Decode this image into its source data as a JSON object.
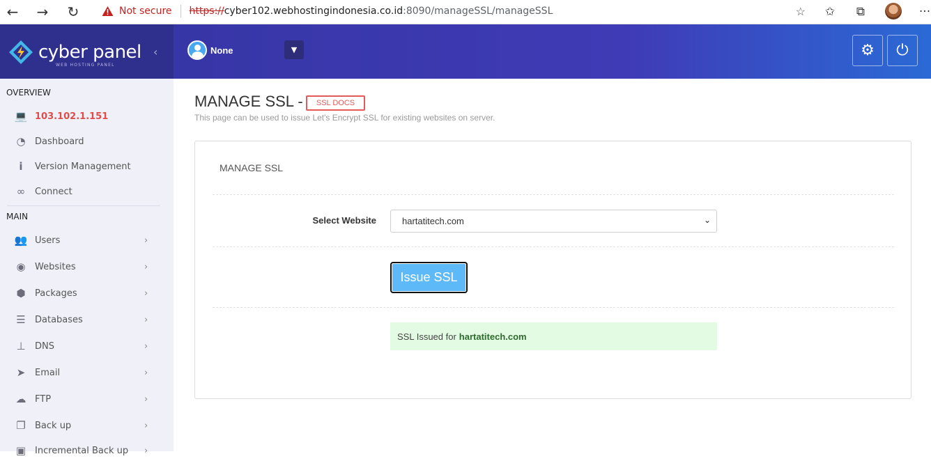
{
  "browser": {
    "security_label": "Not secure",
    "url_scheme": "https://",
    "url_host": "cyber102.webhostingindonesia.co.id",
    "url_rest": ":8090/manageSSL/manageSSL",
    "icons": [
      "back-icon",
      "forward-icon",
      "reload-icon",
      "warning-icon",
      "add-favorite-icon",
      "favorites-icon",
      "collections-icon",
      "profile-avatar",
      "more-icon"
    ]
  },
  "brand": {
    "name": "cyber panel",
    "tagline": "WEB HOSTING PANEL"
  },
  "sidebar": {
    "overview_heading": "OVERVIEW",
    "main_heading": "MAIN",
    "overview_items": [
      {
        "label": "103.102.1.151",
        "icon": "laptop-icon"
      },
      {
        "label": "Dashboard",
        "icon": "dashboard-icon"
      },
      {
        "label": "Version Management",
        "icon": "info-icon"
      },
      {
        "label": "Connect",
        "icon": "link-icon"
      }
    ],
    "main_items": [
      {
        "label": "Users",
        "icon": "users-icon"
      },
      {
        "label": "Websites",
        "icon": "globe-icon"
      },
      {
        "label": "Packages",
        "icon": "cubes-icon"
      },
      {
        "label": "Databases",
        "icon": "database-icon"
      },
      {
        "label": "DNS",
        "icon": "sitemap-icon"
      },
      {
        "label": "Email",
        "icon": "paper-plane-icon"
      },
      {
        "label": "FTP",
        "icon": "cloud-upload-icon"
      },
      {
        "label": "Back up",
        "icon": "copy-icon"
      },
      {
        "label": "Incremental Back up",
        "icon": "save-icon"
      }
    ]
  },
  "header": {
    "user_name": "None"
  },
  "main": {
    "page_title": "MANAGE SSL -",
    "docs_label": "SSL DOCS",
    "description": "This page can be used to issue Let's Encrypt SSL for existing websites on server.",
    "panel_title": "MANAGE SSL",
    "select_label": "Select Website",
    "selected_website": "hartatitech.com",
    "issue_button": "Issue SSL",
    "alert_text": "SSL Issued for",
    "alert_site": "hartatitech.com"
  },
  "colors": {
    "brand_bg": "#2f2f8e",
    "header_gradient_start": "#3736a6",
    "header_gradient_end": "#2b6ad6",
    "sidebar_bg": "#f0f0f8",
    "accent_red": "#e25a5a",
    "button_blue": "#5eb9f8",
    "success_bg": "#e3fbe3"
  }
}
